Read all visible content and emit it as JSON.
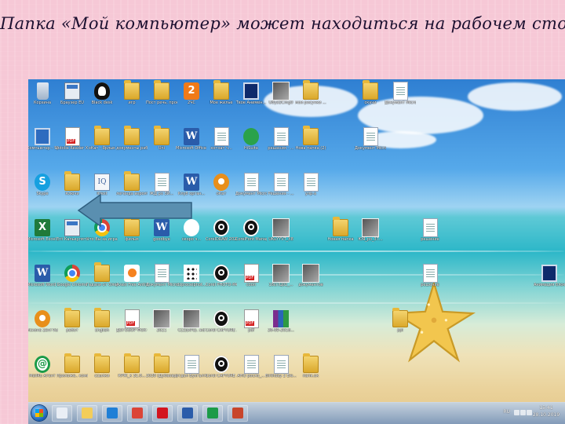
{
  "slide": {
    "title": "Папка «Мой компьютер» может находиться на рабочем столе"
  },
  "desktop": {
    "icons": [
      {
        "label": "Корзина",
        "icon": "recycle-bin-icon"
      },
      {
        "label": "Браузер EU",
        "icon": "calculator-icon"
      },
      {
        "label": "Black desk",
        "icon": "penguin-icon"
      },
      {
        "label": "игр",
        "icon": "folder-icon"
      },
      {
        "label": "Пост речь, проект В...",
        "icon": "folder-icon"
      },
      {
        "label": "2ЧС",
        "icon": "orange-app-icon"
      },
      {
        "label": "Мое жилье",
        "icon": "folder-icon"
      },
      {
        "label": "Твое Анимен...",
        "icon": "monitor-icon"
      },
      {
        "label": "U8yst/Cmg0",
        "icon": "photo-icon"
      },
      {
        "label": "мои рисунки ...",
        "icon": "folder-icon"
      },
      {
        "label": "скачи",
        "icon": "folder-icon"
      },
      {
        "label": "Документ Microsoft ...",
        "icon": "document-icon"
      },
      {
        "label": "Компьютер - Ярлык",
        "icon": "computer-icon"
      },
      {
        "label": "Adobe Reader X",
        "icon": "pdf-icon"
      },
      {
        "label": "оКат - Ярлык",
        "icon": "folder-icon"
      },
      {
        "label": "документы рабочие",
        "icon": "folder-icon"
      },
      {
        "label": "Uni",
        "icon": "folder-icon"
      },
      {
        "label": "Microsoft Office Wo...",
        "icon": "word-icon"
      },
      {
        "label": "котоат ч...",
        "icon": "document-icon"
      },
      {
        "label": "HiSuite",
        "icon": "green-arrow-icon"
      },
      {
        "label": "решения - ...",
        "icon": "document-icon"
      },
      {
        "label": "Нова папка (2)",
        "icon": "folder-icon"
      },
      {
        "label": "Документ Microsoft ...",
        "icon": "document-icon"
      },
      {
        "label": "Skype",
        "icon": "skype-icon"
      },
      {
        "label": "Ключи",
        "icon": "folder-icon"
      },
      {
        "label": "IQext",
        "icon": "iq-icon"
      },
      {
        "label": "легенда вероятност...",
        "icon": "folder-icon"
      },
      {
        "label": "ЖД ро ЗИ...",
        "icon": "document-icon"
      },
      {
        "label": "Клуб орган...",
        "icon": "word-icon"
      },
      {
        "label": "оКат",
        "icon": "gear-icon"
      },
      {
        "label": "Документ Microsoft ...",
        "icon": "document-icon"
      },
      {
        "label": "Решения - ...",
        "icon": "document-icon"
      },
      {
        "label": "улр-а",
        "icon": "document-icon"
      },
      {
        "label": "Microsoft Excel 2010",
        "icon": "excel-icon"
      },
      {
        "label": "Ent Калькулятор",
        "icon": "calculator-icon"
      },
      {
        "label": "Что Вы за игра",
        "icon": "chrome-icon"
      },
      {
        "label": "фильм",
        "icon": "folder-icon"
      },
      {
        "label": "goodbye",
        "icon": "word-icon"
      },
      {
        "label": "скоро ч...",
        "icon": "scissors-icon"
      },
      {
        "label": "CorelDRAW 2020 (64 Bit)",
        "icon": "corel-icon"
      },
      {
        "label": "CorelFont Manager 2...",
        "icon": "corel-icon"
      },
      {
        "label": "UKuYYVT_X8",
        "icon": "photo-icon"
      },
      {
        "label": "Новая папка",
        "icon": "folder-icon"
      },
      {
        "label": "ЮЯ_ро_3Т...",
        "icon": "photo-icon"
      },
      {
        "label": "решение",
        "icon": "document-icon"
      },
      {
        "label": "Microsoft Word 2010",
        "icon": "word-icon"
      },
      {
        "label": "Google Chrome",
        "icon": "chrome-icon"
      },
      {
        "label": "Гадали от Олеркие(4)...",
        "icon": "folder-icon"
      },
      {
        "label": "Avast Free Antivirus",
        "icon": "avast-icon"
      },
      {
        "label": "Документ Microso...",
        "icon": "document-icon"
      },
      {
        "label": "dzprocelphot...",
        "icon": "dots-icon"
      },
      {
        "label": "Corel PHOTO-PA...",
        "icon": "corel-icon"
      },
      {
        "label": "сооп",
        "icon": "pdf-icon"
      },
      {
        "label": "18сг/Ц02_...",
        "icon": "photo-icon"
      },
      {
        "label": "документов",
        "icon": "photo-icon"
      },
      {
        "label": "решение",
        "icon": "document-icon"
      },
      {
        "label": "Анимация блок ...",
        "icon": "monitor-icon"
      },
      {
        "label": "Искона Zevi Vun",
        "icon": "gear-icon"
      },
      {
        "label": "работ",
        "icon": "folder-icon"
      },
      {
        "label": "English",
        "icon": "folder-icon"
      },
      {
        "label": "ДОГОВОР ФОХ Сер...",
        "icon": "pdf-icon"
      },
      {
        "label": "2021",
        "icon": "photo-icon"
      },
      {
        "label": "С(2)(кРе). жd",
        "icon": "photo-icon"
      },
      {
        "label": "Corel CAPTURE ...",
        "icon": "corel-icon"
      },
      {
        "label": "pdf",
        "icon": "pdf-icon"
      },
      {
        "label": "26-09-2018...",
        "icon": "archive-icon"
      },
      {
        "label": "ppl",
        "icon": "folder-icon"
      },
      {
        "label": "MailRu Агент",
        "icon": "mail-agent-icon"
      },
      {
        "label": "Приложе.. компьюте...",
        "icon": "folder-icon"
      },
      {
        "label": "ссылки",
        "icon": "folder-icon"
      },
      {
        "label": "КРЖ_к 31.0...",
        "icon": "folder-icon"
      },
      {
        "label": "2020 (Дубаевр)",
        "icon": "folder-icon"
      },
      {
        "label": "отдел Бухгалтер...",
        "icon": "document-icon"
      },
      {
        "label": "Corel CAPTURE ...",
        "icon": "corel-icon"
      },
      {
        "label": "АНО росло_...",
        "icon": "document-icon"
      },
      {
        "label": "Birthday 2 Ele...",
        "icon": "document-icon"
      },
      {
        "label": "папк.ок",
        "icon": "folder-icon"
      }
    ]
  },
  "taskbar": {
    "language": "RU",
    "time": "15:41",
    "date": "28.10.2019",
    "pinned": [
      {
        "name": "hp-icon",
        "color": "#e9eef5"
      },
      {
        "name": "file-manager-icon",
        "color": "#f3cd5a"
      },
      {
        "name": "internet-explorer-icon",
        "color": "#1f7fd6"
      },
      {
        "name": "chrome-icon",
        "color": "#db4437"
      },
      {
        "name": "opera-icon",
        "color": "#d3141f"
      },
      {
        "name": "word-icon",
        "color": "#2a5caa"
      },
      {
        "name": "mail-agent-icon",
        "color": "#1c9b48"
      },
      {
        "name": "presentation-icon",
        "color": "#c8452b"
      }
    ]
  },
  "overlay": {
    "arrow_color": "#5a8fb0"
  }
}
